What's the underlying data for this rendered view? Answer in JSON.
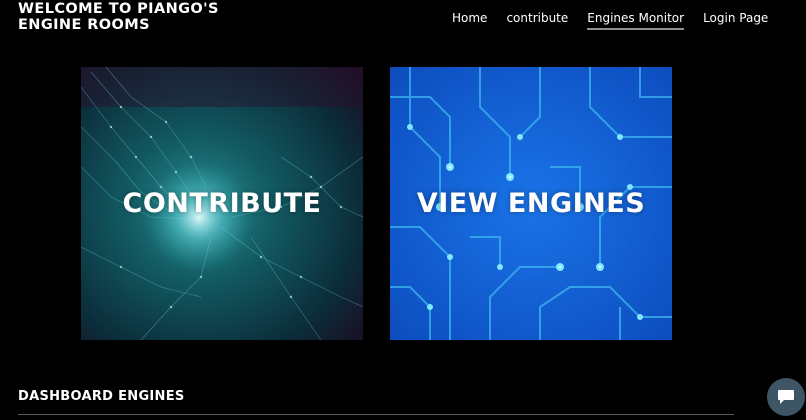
{
  "header": {
    "site_title": "WELCOME TO PIANGO'S ENGINE ROOMS"
  },
  "nav": {
    "items": [
      {
        "label": "Home",
        "active": false
      },
      {
        "label": "contribute",
        "active": false
      },
      {
        "label": "Engines Monitor",
        "active": true
      },
      {
        "label": "Login Page",
        "active": false
      }
    ]
  },
  "tiles": {
    "contribute": {
      "label": "CONTRIBUTE"
    },
    "engines": {
      "label": "VIEW ENGINES"
    }
  },
  "dashboard": {
    "title": "DASHBOARD ENGINES"
  },
  "chat": {
    "icon": "chat-bubble-icon",
    "color": "#3e5566"
  },
  "colors": {
    "background": "#000000",
    "nav_underline": "#8d8d8d",
    "tile_contribute": "#0f4b52",
    "tile_engines": "#0b5bd4"
  }
}
